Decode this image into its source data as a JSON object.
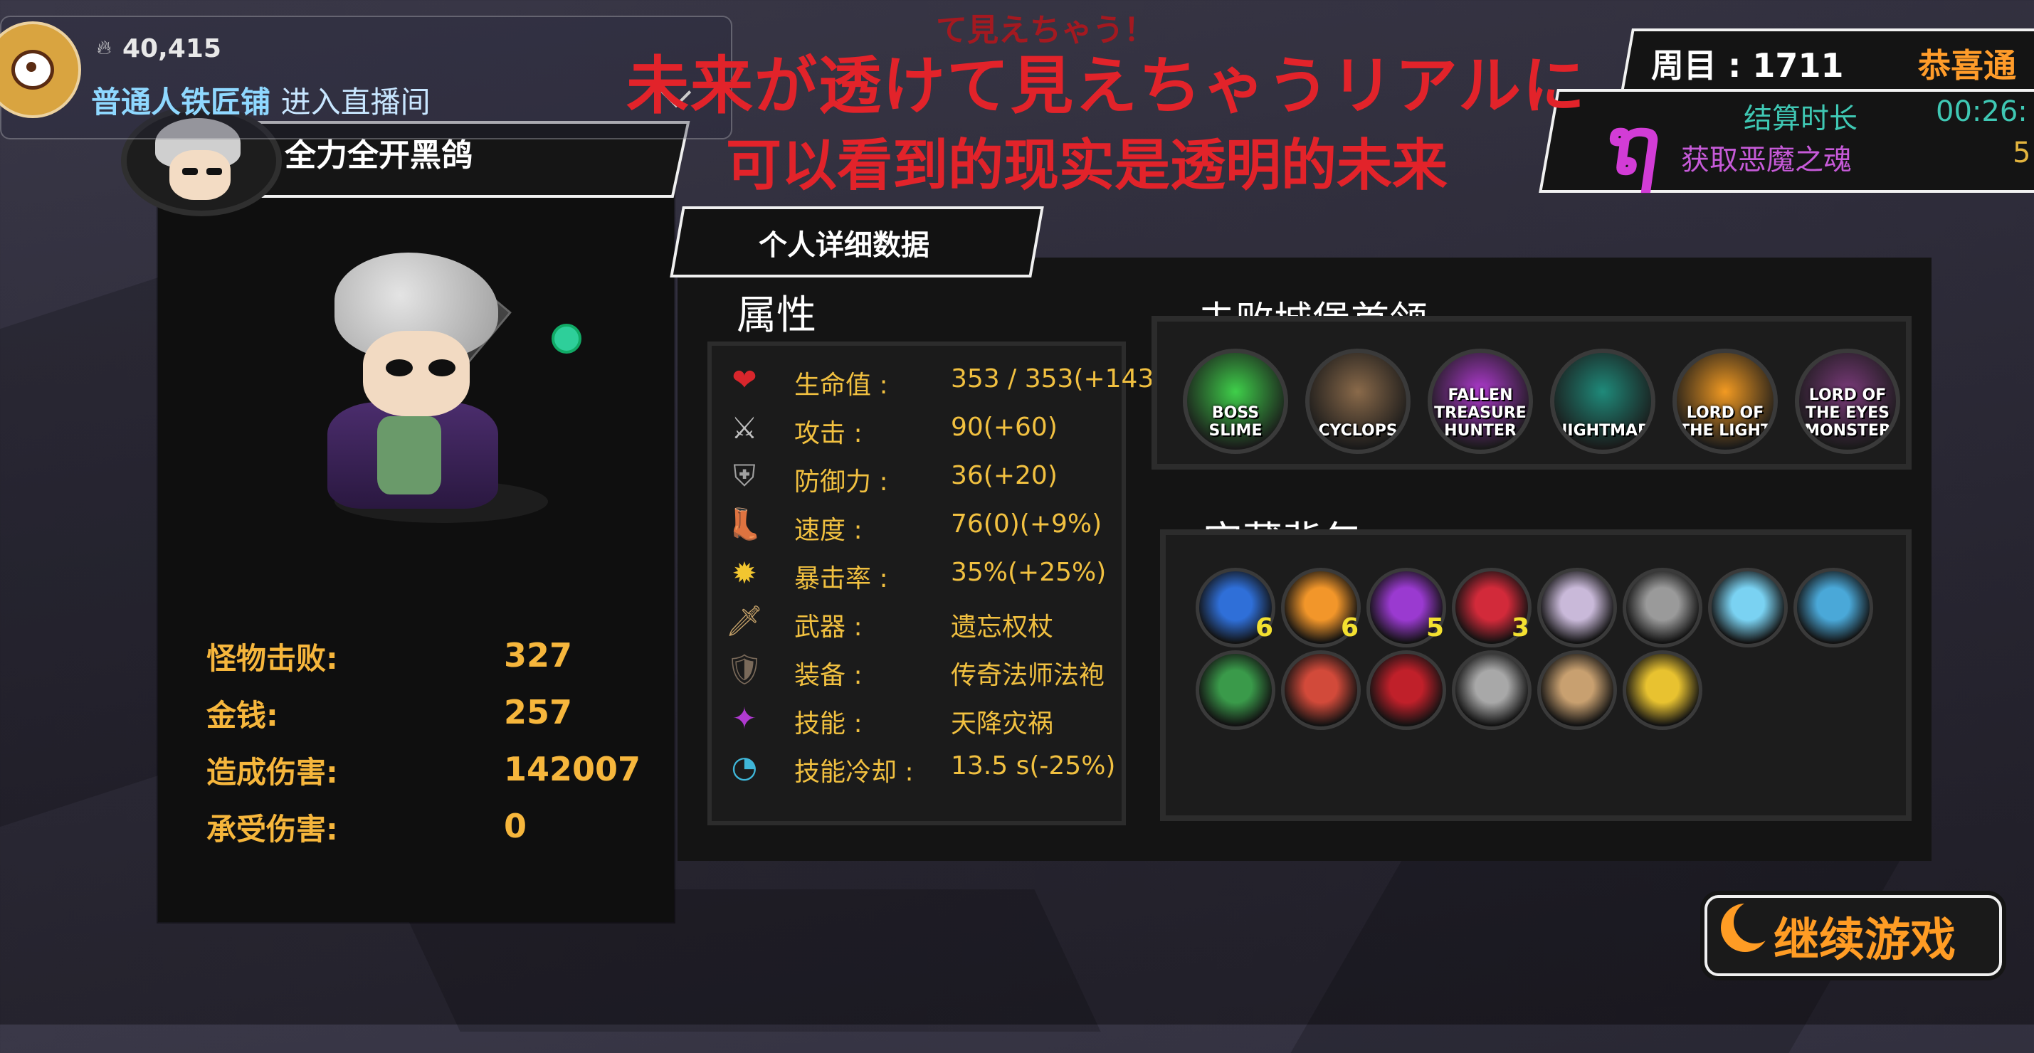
{
  "live": {
    "viewer_count": "40,415",
    "channel_name": "普通人铁匠铺",
    "enter_label": "进入直播间"
  },
  "player": {
    "name": "全力全开黑鸽"
  },
  "subtitles": {
    "faint_line": "て見えちゃう！",
    "japanese": "未来が透けて見えちゃうリアルに",
    "chinese": "可以看到的现实是透明的未来"
  },
  "round": {
    "label": "周目 : 1711",
    "congrats": "恭喜通",
    "settle_label": "结算时长",
    "settle_value": "00:26:",
    "soul_label": "获取恶魔之魂",
    "soul_value": "5"
  },
  "left_stats": [
    {
      "label": "怪物击败:",
      "value": "327"
    },
    {
      "label": "金钱:",
      "value": "257"
    },
    {
      "label": "造成伤害:",
      "value": "142007"
    },
    {
      "label": "承受伤害:",
      "value": "0"
    }
  ],
  "detail_tab": {
    "label": "个人详细数据"
  },
  "attributes": {
    "title": "属性",
    "items": [
      {
        "icon": "heart-icon",
        "label": "生命值 :",
        "value": "353 / 353(+143)",
        "color": "#d8262c"
      },
      {
        "icon": "sword-icon",
        "label": "攻击 :",
        "value": "90(+60)",
        "color": "#bdbdbd"
      },
      {
        "icon": "shield-icon",
        "label": "防御力 :",
        "value": "36(+20)",
        "color": "#a0a0a0"
      },
      {
        "icon": "boot-icon",
        "label": "速度 :",
        "value": "76(0)(+9%)",
        "color": "#8a6a4a"
      },
      {
        "icon": "crit-icon",
        "label": "暴击率 :",
        "value": "35%(+25%)",
        "color": "#f2c630"
      },
      {
        "icon": "weapon-icon",
        "label": "武器 :",
        "value": "遗忘权杖",
        "color": "#c7a36a"
      },
      {
        "icon": "armor-icon",
        "label": "装备 :",
        "value": "传奇法师法袍",
        "color": "#7a6a5a"
      },
      {
        "icon": "skill-icon",
        "label": "技能 :",
        "value": "天降灾祸",
        "color": "#b03ad0"
      },
      {
        "icon": "cooldown-icon",
        "label": "技能冷却 :",
        "value": "13.5 s(-25%)",
        "color": "#3fb6d8"
      }
    ]
  },
  "bosses": {
    "title": "击败城堡首领",
    "items": [
      {
        "name": "BOSS SLIME",
        "color": "#3fcf4a"
      },
      {
        "name": "CYCLOPS",
        "color": "#8a6a4a"
      },
      {
        "name": "FALLEN TREASURE HUNTER",
        "color": "#b03ad0"
      },
      {
        "name": "NIGHTMARE",
        "color": "#1f8a7a"
      },
      {
        "name": "LORD OF THE LIGHT",
        "color": "#f29a22"
      },
      {
        "name": "LORD OF THE EYES MONSTER",
        "color": "#7a3a7a"
      }
    ]
  },
  "treasure": {
    "title": "宝藏背包",
    "items": [
      {
        "icon": "blue-crystal-icon",
        "count": "6",
        "color": "#2f6fd8"
      },
      {
        "icon": "orange-crystal-icon",
        "count": "6",
        "color": "#f2962a"
      },
      {
        "icon": "purple-crystal-icon",
        "count": "5",
        "color": "#9a3ad0"
      },
      {
        "icon": "red-crystal-icon",
        "count": "3",
        "color": "#d22a3a"
      },
      {
        "icon": "bone-icon",
        "count": "",
        "color": "#c9b9d9"
      },
      {
        "icon": "helmet-icon",
        "count": "",
        "color": "#9a9a9a"
      },
      {
        "icon": "ice-shard-icon",
        "count": "",
        "color": "#7ad2f2"
      },
      {
        "icon": "frost-claw-icon",
        "count": "",
        "color": "#4aa8d8"
      },
      {
        "icon": "green-orb-icon",
        "count": "",
        "color": "#3a9a4a"
      },
      {
        "icon": "lantern-icon",
        "count": "",
        "color": "#d24a3a"
      },
      {
        "icon": "blood-blade-icon",
        "count": "",
        "color": "#c0202a"
      },
      {
        "icon": "gauntlet-icon",
        "count": "",
        "color": "#a8a8a8"
      },
      {
        "icon": "boot-icon",
        "count": "",
        "color": "#c8a070"
      },
      {
        "icon": "golden-emblem-icon",
        "count": "",
        "color": "#e8c230"
      }
    ]
  },
  "continue_button": {
    "label": "继续游戏"
  },
  "colors": {
    "accent": "#f6b63c",
    "subtitle": "#e2232a",
    "continue": "#ff9c24"
  }
}
